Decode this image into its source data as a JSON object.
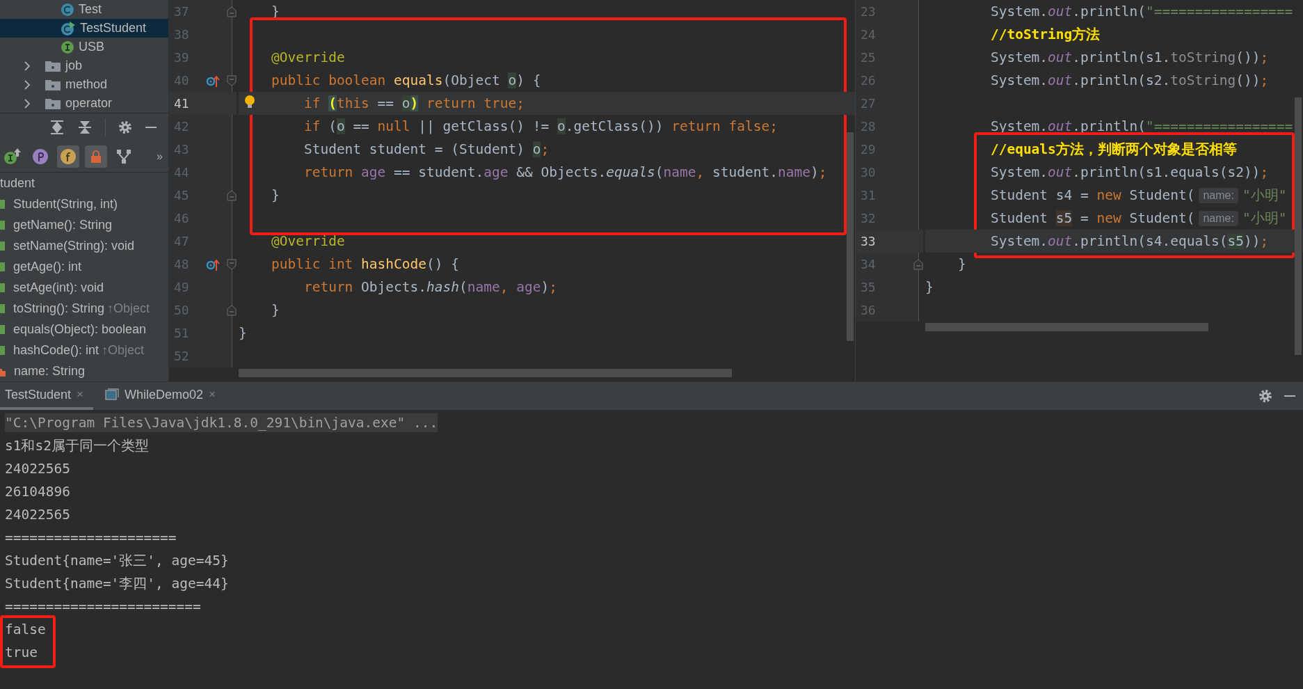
{
  "sidebar": {
    "project_tree": [
      {
        "label": "Test",
        "kind": "class",
        "selected": false
      },
      {
        "label": "TestStudent",
        "kind": "class-run",
        "selected": true
      },
      {
        "label": "USB",
        "kind": "interface",
        "selected": false
      },
      {
        "label": "job",
        "kind": "folder",
        "selected": false,
        "expanded": false
      },
      {
        "label": "method",
        "kind": "folder",
        "selected": false,
        "expanded": false
      },
      {
        "label": "operator",
        "kind": "folder",
        "selected": false,
        "expanded": false
      }
    ],
    "structure_filters": [
      {
        "kind": "inherited",
        "selected": false
      },
      {
        "kind": "properties",
        "selected": false
      },
      {
        "kind": "fields",
        "selected": true
      },
      {
        "kind": "non-public",
        "selected": true
      },
      {
        "kind": "anonymous",
        "selected": false
      }
    ],
    "filters_more": "»",
    "structure_root": "tudent",
    "structure_members": [
      {
        "label": "Student(String, int)",
        "kind": "method"
      },
      {
        "label": "getName(): String",
        "kind": "method"
      },
      {
        "label": "setName(String): void",
        "kind": "method"
      },
      {
        "label": "getAge(): int",
        "kind": "method"
      },
      {
        "label": "setAge(int): void",
        "kind": "method"
      },
      {
        "label": "toString(): String",
        "inherited": "↑Object",
        "kind": "method"
      },
      {
        "label": "equals(Object): boolean",
        "kind": "method"
      },
      {
        "label": "hashCode(): int",
        "inherited": "↑Object",
        "kind": "method"
      },
      {
        "label": "name: String",
        "kind": "field"
      }
    ]
  },
  "left_editor": {
    "blocks": [
      {
        "boxed": false,
        "lines": [
          {
            "number": "37",
            "tokens": [
              {
                "text": "    }",
                "kind": "plain"
              }
            ],
            "icons": [
              {
                "kind": "fold-end"
              }
            ],
            "current": false
          }
        ]
      },
      {
        "boxed": true,
        "lines": [
          {
            "number": "38",
            "current": false
          },
          {
            "number": "39",
            "tokens": [
              {
                "text": "    @Override",
                "kind": "annotation"
              }
            ],
            "current": false
          },
          {
            "number": "40",
            "tokens": [
              {
                "text": "    public boolean ",
                "kind": "keyword"
              },
              {
                "text": "equals",
                "kind": "declaration"
              },
              {
                "text": "(Object ",
                "kind": "plain"
              },
              {
                "text": "o",
                "kind": "usage"
              },
              {
                "text": ") {",
                "kind": "plain"
              }
            ],
            "icons": [
              {
                "kind": "override"
              },
              {
                "kind": "fold-start"
              }
            ],
            "current": false
          },
          {
            "number": "41",
            "tokens": [
              {
                "text": "        if ",
                "kind": "keyword"
              },
              {
                "text": "(",
                "kind": "brace-match"
              },
              {
                "text": "this",
                "kind": "keyword"
              },
              {
                "text": " == ",
                "kind": "plain"
              },
              {
                "text": "o",
                "kind": "usage"
              },
              {
                "text": ")",
                "kind": "brace-match"
              },
              {
                "text": " return true;",
                "kind": "keyword"
              }
            ],
            "icons": [
              {
                "kind": "bulb"
              }
            ],
            "current": true
          },
          {
            "number": "42",
            "tokens": [
              {
                "text": "        if ",
                "kind": "keyword"
              },
              {
                "text": "(",
                "kind": "plain"
              },
              {
                "text": "o",
                "kind": "usage"
              },
              {
                "text": " == ",
                "kind": "plain"
              },
              {
                "text": "null",
                "kind": "keyword"
              },
              {
                "text": " || getClass() != ",
                "kind": "plain"
              },
              {
                "text": "o",
                "kind": "usage"
              },
              {
                "text": ".getClass()) ",
                "kind": "plain"
              },
              {
                "text": "return false;",
                "kind": "keyword"
              }
            ],
            "current": false
          },
          {
            "number": "43",
            "tokens": [
              {
                "text": "        Student student = (Student) ",
                "kind": "plain"
              },
              {
                "text": "o",
                "kind": "usage"
              },
              {
                "text": ";",
                "kind": "keyword"
              }
            ],
            "current": false
          },
          {
            "number": "44",
            "tokens": [
              {
                "text": "        return ",
                "kind": "keyword"
              },
              {
                "text": "age",
                "kind": "field"
              },
              {
                "text": " == student.",
                "kind": "plain"
              },
              {
                "text": "age",
                "kind": "field"
              },
              {
                "text": " && Objects.",
                "kind": "plain"
              },
              {
                "text": "equals",
                "kind": "static-call"
              },
              {
                "text": "(",
                "kind": "plain"
              },
              {
                "text": "name",
                "kind": "field"
              },
              {
                "text": ", ",
                "kind": "keyword"
              },
              {
                "text": "student.",
                "kind": "plain"
              },
              {
                "text": "name",
                "kind": "field"
              },
              {
                "text": ")",
                "kind": "plain"
              },
              {
                "text": ";",
                "kind": "keyword"
              }
            ],
            "current": false
          },
          {
            "number": "45",
            "tokens": [
              {
                "text": "    }",
                "kind": "plain"
              }
            ],
            "icons": [
              {
                "kind": "fold-end"
              }
            ],
            "current": false
          },
          {
            "number": "46",
            "current": false
          }
        ]
      },
      {
        "boxed": false,
        "lines": [
          {
            "number": "47",
            "tokens": [
              {
                "text": "    @Override",
                "kind": "annotation"
              }
            ],
            "current": false
          },
          {
            "number": "48",
            "tokens": [
              {
                "text": "    public int ",
                "kind": "keyword"
              },
              {
                "text": "hashCode",
                "kind": "declaration"
              },
              {
                "text": "() {",
                "kind": "plain"
              }
            ],
            "icons": [
              {
                "kind": "override"
              },
              {
                "kind": "fold-start"
              }
            ],
            "current": false
          },
          {
            "number": "49",
            "tokens": [
              {
                "text": "        return ",
                "kind": "keyword"
              },
              {
                "text": "Objects.",
                "kind": "plain"
              },
              {
                "text": "hash",
                "kind": "static-call"
              },
              {
                "text": "(",
                "kind": "plain"
              },
              {
                "text": "name",
                "kind": "field"
              },
              {
                "text": ", ",
                "kind": "keyword"
              },
              {
                "text": "age",
                "kind": "field"
              },
              {
                "text": ")",
                "kind": "plain"
              },
              {
                "text": ";",
                "kind": "keyword"
              }
            ],
            "current": false
          },
          {
            "number": "50",
            "tokens": [
              {
                "text": "    }",
                "kind": "plain"
              }
            ],
            "icons": [
              {
                "kind": "fold-end"
              }
            ],
            "current": false
          },
          {
            "number": "51",
            "tokens": [
              {
                "text": "}",
                "kind": "plain"
              }
            ],
            "current": false
          },
          {
            "number": "52",
            "current": false
          }
        ]
      }
    ]
  },
  "right_editor": {
    "blocks": [
      {
        "boxed": false,
        "lines": [
          {
            "number": "23",
            "tokens": [
              {
                "text": "        System.",
                "kind": "plain"
              },
              {
                "text": "out",
                "kind": "static-field"
              },
              {
                "text": ".println(",
                "kind": "plain"
              },
              {
                "text": "\"=================",
                "kind": "string"
              }
            ],
            "current": false
          },
          {
            "number": "24",
            "tokens": [
              {
                "text": "        //toString方法",
                "kind": "comment"
              }
            ],
            "current": false
          },
          {
            "number": "25",
            "tokens": [
              {
                "text": "        System.",
                "kind": "plain"
              },
              {
                "text": "out",
                "kind": "static-field"
              },
              {
                "text": ".println(s1.",
                "kind": "plain"
              },
              {
                "text": "toString",
                "kind": "dim"
              },
              {
                "text": "())",
                "kind": "plain"
              },
              {
                "text": ";",
                "kind": "keyword"
              }
            ],
            "current": false
          },
          {
            "number": "26",
            "tokens": [
              {
                "text": "        System.",
                "kind": "plain"
              },
              {
                "text": "out",
                "kind": "static-field"
              },
              {
                "text": ".println(s2.",
                "kind": "plain"
              },
              {
                "text": "toString",
                "kind": "dim"
              },
              {
                "text": "())",
                "kind": "plain"
              },
              {
                "text": ";",
                "kind": "keyword"
              }
            ],
            "current": false
          },
          {
            "number": "27",
            "current": false
          },
          {
            "number": "28",
            "tokens": [
              {
                "text": "        System.",
                "kind": "plain"
              },
              {
                "text": "out",
                "kind": "static-field"
              },
              {
                "text": ".println(",
                "kind": "plain"
              },
              {
                "text": "\"=================",
                "kind": "string"
              }
            ],
            "current": false
          }
        ]
      },
      {
        "boxed": true,
        "lines": [
          {
            "number": "29",
            "tokens": [
              {
                "text": "        //equals方法，判断两个对象是否相等",
                "kind": "comment"
              }
            ],
            "current": false
          },
          {
            "number": "30",
            "tokens": [
              {
                "text": "        System.",
                "kind": "plain"
              },
              {
                "text": "out",
                "kind": "static-field"
              },
              {
                "text": ".println(s1.equals(s2))",
                "kind": "plain"
              },
              {
                "text": ";",
                "kind": "keyword"
              }
            ],
            "current": false
          },
          {
            "number": "31",
            "tokens": [
              {
                "text": "        Student s4 = ",
                "kind": "plain"
              },
              {
                "text": "new",
                "kind": "keyword"
              },
              {
                "text": " Student(",
                "kind": "plain"
              },
              {
                "text": "name:",
                "kind": "hint"
              },
              {
                "text": "\"小明\"",
                "kind": "string"
              }
            ],
            "current": false
          },
          {
            "number": "32",
            "tokens": [
              {
                "text": "        Student ",
                "kind": "plain"
              },
              {
                "text": "s5",
                "kind": "write-usage"
              },
              {
                "text": " = ",
                "kind": "plain"
              },
              {
                "text": "new",
                "kind": "keyword"
              },
              {
                "text": " Student(",
                "kind": "plain"
              },
              {
                "text": "name:",
                "kind": "hint"
              },
              {
                "text": "\"小明\"",
                "kind": "string"
              }
            ],
            "current": false
          },
          {
            "number": "33",
            "tokens": [
              {
                "text": "        System.",
                "kind": "plain"
              },
              {
                "text": "out",
                "kind": "static-field"
              },
              {
                "text": ".println(s4.equals(",
                "kind": "plain"
              },
              {
                "text": "s5",
                "kind": "usage"
              },
              {
                "text": "))",
                "kind": "plain"
              },
              {
                "text": ";",
                "kind": "keyword"
              }
            ],
            "current": true
          }
        ]
      },
      {
        "boxed": false,
        "lines": [
          {
            "number": "34",
            "tokens": [
              {
                "text": "    }",
                "kind": "plain"
              }
            ],
            "icons": [
              {
                "kind": "fold-end"
              }
            ],
            "current": false
          },
          {
            "number": "35",
            "tokens": [
              {
                "text": "}",
                "kind": "plain"
              }
            ],
            "current": false
          },
          {
            "number": "36",
            "current": false
          }
        ]
      }
    ]
  },
  "run_panel": {
    "tabs": [
      {
        "label": "TestStudent",
        "kind": "plain",
        "selected": true,
        "close": "×"
      },
      {
        "label": "WhileDemo02",
        "kind": "window",
        "selected": false,
        "close": "×"
      }
    ],
    "console": [
      {
        "boxed": false,
        "lines": [
          {
            "text": "\"C:\\Program Files\\Java\\jdk1.8.0_291\\bin\\java.exe\" ...",
            "kind": "command"
          },
          {
            "text": "s1和s2属于同一个类型",
            "kind": "output"
          },
          {
            "text": "24022565",
            "kind": "output"
          },
          {
            "text": "26104896",
            "kind": "output"
          },
          {
            "text": "24022565",
            "kind": "output"
          },
          {
            "text": "=====================",
            "kind": "output"
          },
          {
            "text": "Student{name='张三', age=45}",
            "kind": "output"
          },
          {
            "text": "Student{name='李四', age=44}",
            "kind": "output"
          },
          {
            "text": "========================",
            "kind": "output"
          }
        ]
      },
      {
        "boxed": true,
        "lines": [
          {
            "text": "false",
            "kind": "output"
          },
          {
            "text": "true",
            "kind": "output"
          }
        ]
      }
    ]
  }
}
